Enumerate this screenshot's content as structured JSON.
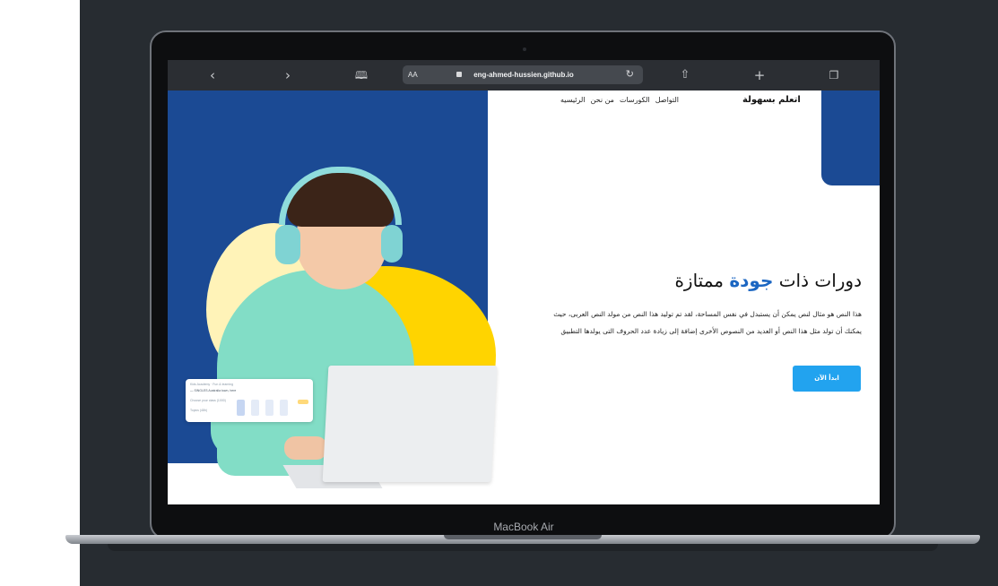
{
  "device": {
    "label": "MacBook Air"
  },
  "browser": {
    "url": "eng-ahmed-hussien.github.io",
    "reader_label": "AA",
    "icons": {
      "back": "chevron-left-icon",
      "forward": "chevron-right-icon",
      "bookmarks": "book-icon",
      "reload": "reload-icon",
      "share": "share-icon",
      "new_tab": "plus-icon",
      "tabs": "tabs-icon"
    }
  },
  "site": {
    "brand": "اتعلم بسهولة",
    "nav": [
      "الرئيسيه",
      "من نحن",
      "الكورسات",
      "التواصل"
    ],
    "hero": {
      "title_before": "دورات ذات ",
      "title_accent": "جودة",
      "title_after": " ممتازة",
      "description": "هذا النص هو مثال لنص يمكن أن يستبدل في نفس المساحة، لقد تم توليد هذا النص من مولد النص العربى، حيث يمكنك أن تولد مثل هذا النص أو العديد من النصوص الأخرى إضافة إلى زيادة عدد الحروف التى يولدها التطبيق",
      "cta_label": "ابدأ الآن"
    },
    "colors": {
      "primary_blue": "#1b4a94",
      "accent_blue": "#1b66c2",
      "cta": "#22a3ef",
      "yellow": "#ffd400"
    },
    "illustration_card": {
      "line1": "Kids Academy · Fun & learning",
      "line2": "— SINGLES Australia town, here",
      "line3": "Choose your class (1000)",
      "line4": "Topics (48h)"
    }
  }
}
